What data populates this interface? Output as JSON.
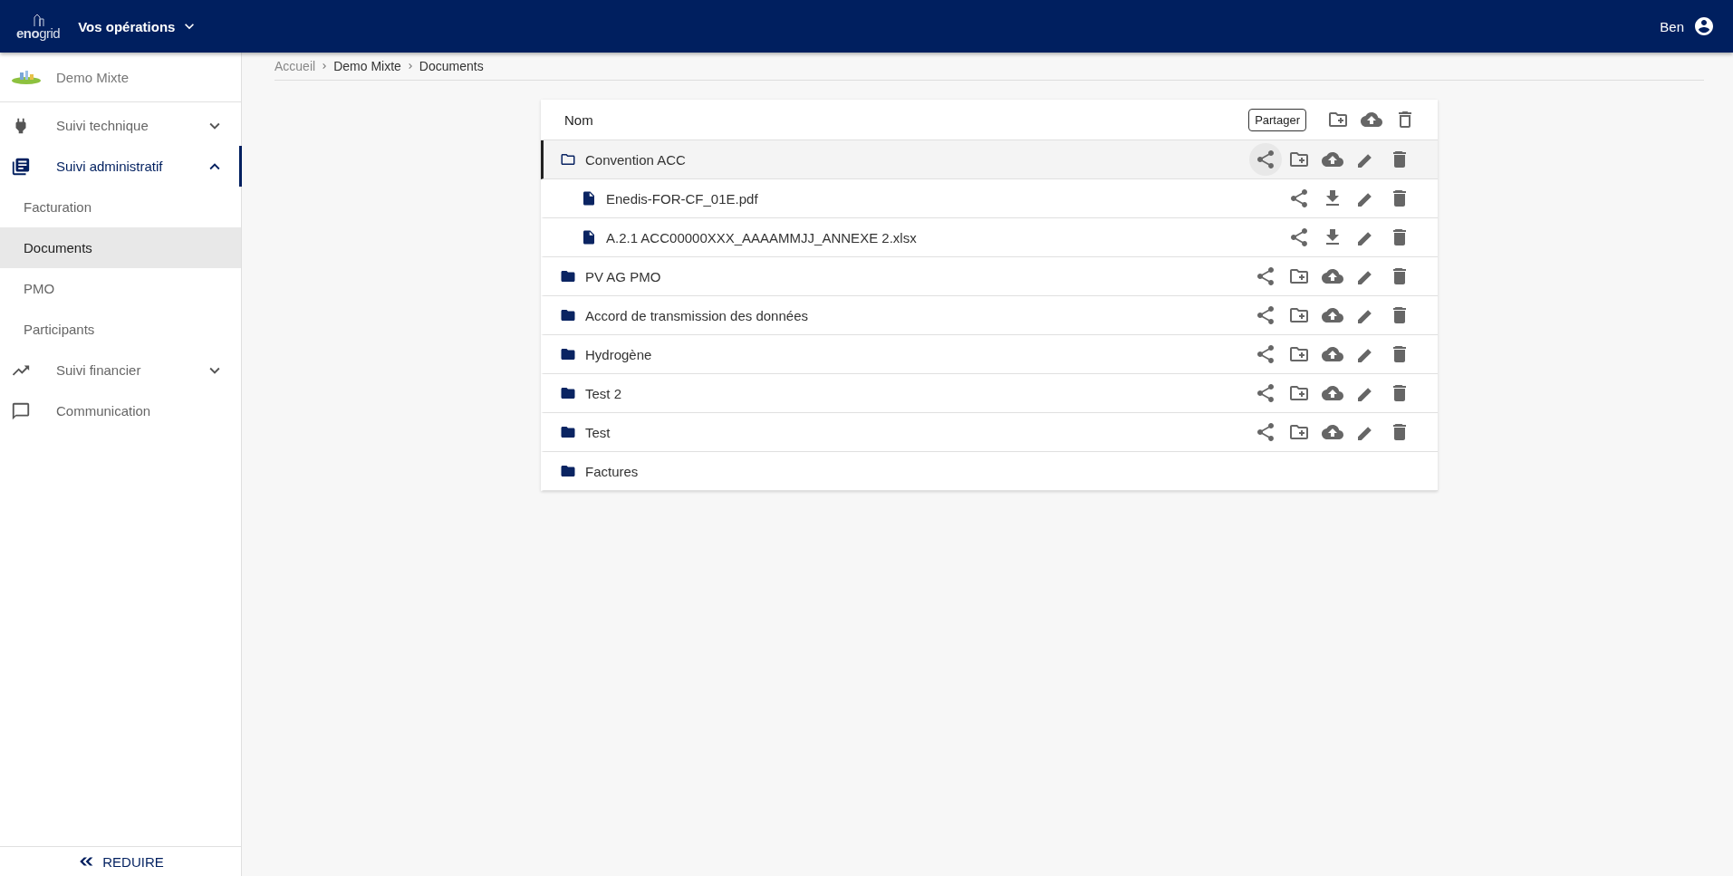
{
  "header": {
    "logo": "**eno**grid",
    "menu_label": "Vos opérations",
    "user": "Ben"
  },
  "sidebar": {
    "project": "Demo Mixte",
    "items": [
      {
        "kind": "section",
        "label": "Suivi technique",
        "expanded": false,
        "selected": false
      },
      {
        "kind": "section",
        "label": "Suivi administratif",
        "expanded": true,
        "selected": true,
        "children": [
          {
            "label": "Facturation",
            "selected": false
          },
          {
            "label": "Documents",
            "selected": true
          },
          {
            "label": "PMO",
            "selected": false
          },
          {
            "label": "Participants",
            "selected": false
          }
        ]
      },
      {
        "kind": "section",
        "label": "Suivi financier",
        "expanded": false,
        "selected": false
      },
      {
        "kind": "link",
        "label": "Communication",
        "selected": false
      }
    ],
    "collapse_label": "REDUIRE"
  },
  "breadcrumb": [
    {
      "label": "Accueil",
      "current": false
    },
    {
      "label": "Demo Mixte",
      "current": true
    },
    {
      "label": "Documents",
      "current": true
    }
  ],
  "table": {
    "column": "Nom",
    "share_button": "Partager",
    "header_actions": [
      {
        "kind": "add_folder"
      },
      {
        "kind": "upload"
      },
      {
        "kind": "delete_outline"
      }
    ],
    "rows": [
      {
        "kind": "folder",
        "name": "Convention ACC",
        "expanded": true,
        "selected": true,
        "actions": [
          {
            "kind": "share"
          },
          {
            "kind": "add_folder"
          },
          {
            "kind": "upload"
          },
          {
            "kind": "edit"
          },
          {
            "kind": "delete"
          }
        ],
        "children": [
          {
            "kind": "file",
            "name": "Enedis-FOR-CF_01E.pdf",
            "selected": false,
            "actions": [
              {
                "kind": "share"
              },
              {
                "kind": "download"
              },
              {
                "kind": "edit"
              },
              {
                "kind": "delete"
              }
            ]
          },
          {
            "kind": "file",
            "name": "A.2.1 ACC00000XXX_AAAAMMJJ_ANNEXE 2.xlsx",
            "selected": false,
            "actions": [
              {
                "kind": "share"
              },
              {
                "kind": "download"
              },
              {
                "kind": "edit"
              },
              {
                "kind": "delete"
              }
            ]
          }
        ]
      },
      {
        "kind": "folder",
        "name": "PV AG PMO",
        "expanded": false,
        "selected": false,
        "actions": [
          {
            "kind": "share"
          },
          {
            "kind": "add_folder"
          },
          {
            "kind": "upload"
          },
          {
            "kind": "edit"
          },
          {
            "kind": "delete"
          }
        ]
      },
      {
        "kind": "folder",
        "name": "Accord de transmission des données",
        "expanded": false,
        "selected": false,
        "actions": [
          {
            "kind": "share"
          },
          {
            "kind": "add_folder"
          },
          {
            "kind": "upload"
          },
          {
            "kind": "edit"
          },
          {
            "kind": "delete"
          }
        ]
      },
      {
        "kind": "folder",
        "name": "Hydrogène",
        "expanded": false,
        "selected": false,
        "actions": [
          {
            "kind": "share"
          },
          {
            "kind": "add_folder"
          },
          {
            "kind": "upload"
          },
          {
            "kind": "edit"
          },
          {
            "kind": "delete"
          }
        ]
      },
      {
        "kind": "folder",
        "name": "Test 2",
        "expanded": false,
        "selected": false,
        "actions": [
          {
            "kind": "share"
          },
          {
            "kind": "add_folder"
          },
          {
            "kind": "upload"
          },
          {
            "kind": "edit"
          },
          {
            "kind": "delete"
          }
        ]
      },
      {
        "kind": "folder",
        "name": "Test",
        "expanded": false,
        "selected": false,
        "actions": [
          {
            "kind": "share"
          },
          {
            "kind": "add_folder"
          },
          {
            "kind": "upload"
          },
          {
            "kind": "edit"
          },
          {
            "kind": "delete"
          }
        ]
      },
      {
        "kind": "folder",
        "name": "Factures",
        "expanded": false,
        "selected": false
      }
    ]
  }
}
